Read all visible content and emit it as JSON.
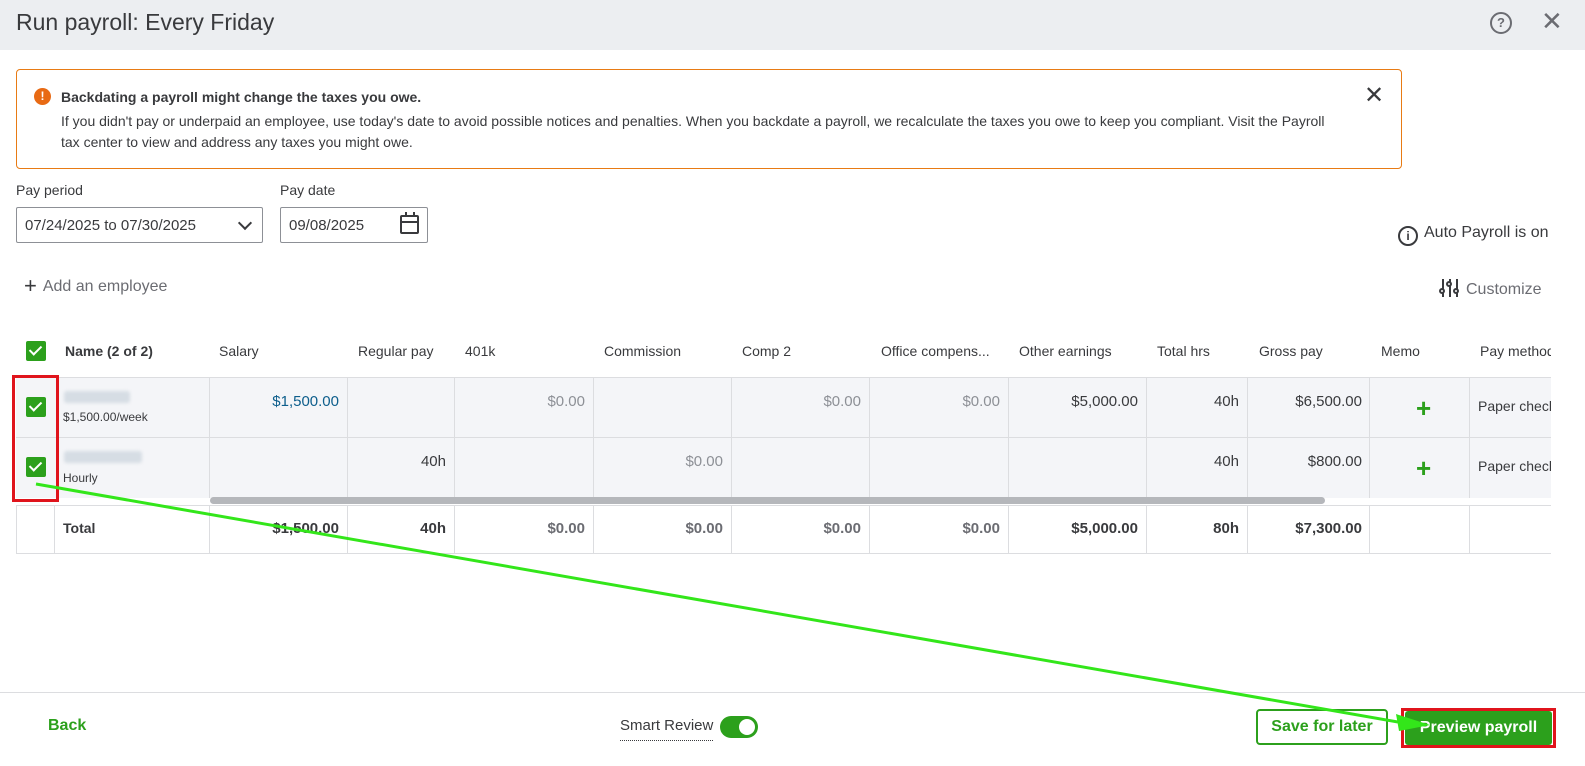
{
  "header": {
    "title": "Run payroll: Every Friday",
    "help_icon": "?",
    "close_icon": "✕"
  },
  "alert": {
    "icon": "!",
    "title": "Backdating a payroll might change the taxes you owe.",
    "body": "If you didn't pay or underpaid an employee, use today's date to avoid possible notices and penalties. When you backdate a payroll, we recalculate the taxes you owe to keep you compliant. Visit the Payroll tax center to view and address any taxes you might owe.",
    "close_icon": "✕"
  },
  "pay_period": {
    "label": "Pay period",
    "value": "07/24/2025 to 07/30/2025"
  },
  "pay_date": {
    "label": "Pay date",
    "value": "09/08/2025"
  },
  "auto_payroll": {
    "icon": "i",
    "text": "Auto Payroll is on"
  },
  "add_employee": {
    "icon": "+",
    "label": "Add an employee"
  },
  "customize": {
    "label": "Customize"
  },
  "table": {
    "headers": {
      "name": "Name (2 of 2)",
      "salary": "Salary",
      "regular_pay": "Regular pay",
      "k401": "401k",
      "commission": "Commission",
      "comp2": "Comp 2",
      "office": "Office compens...",
      "other": "Other earnings",
      "total_hrs": "Total hrs",
      "gross": "Gross pay",
      "memo": "Memo",
      "method": "Pay method"
    },
    "rows": [
      {
        "sub": "$1,500.00/week",
        "salary": "$1,500.00",
        "regular_pay": "",
        "k401": "$0.00",
        "commission": "",
        "comp2": "$0.00",
        "office": "$0.00",
        "other": "$5,000.00",
        "total_hrs": "40h",
        "gross": "$6,500.00",
        "memo": "+",
        "method": "Paper check"
      },
      {
        "sub": "Hourly",
        "salary": "",
        "regular_pay": "40h",
        "k401": "",
        "commission": "$0.00",
        "comp2": "",
        "office": "",
        "other": "",
        "total_hrs": "40h",
        "gross": "$800.00",
        "memo": "+",
        "method": "Paper check"
      }
    ],
    "total": {
      "label": "Total",
      "salary": "$1,500.00",
      "regular_pay": "40h",
      "k401": "$0.00",
      "commission": "$0.00",
      "comp2": "$0.00",
      "office": "$0.00",
      "other": "$5,000.00",
      "total_hrs": "80h",
      "gross": "$7,300.00"
    }
  },
  "footer": {
    "back": "Back",
    "smart_review": "Smart Review",
    "smart_review_on": true,
    "save": "Save for later",
    "preview": "Preview payroll"
  },
  "colors": {
    "brand_green": "#2ca01c",
    "warning_orange": "#e87b14",
    "annotation_red": "#e0141c",
    "annotation_arrow": "#33e61a"
  }
}
